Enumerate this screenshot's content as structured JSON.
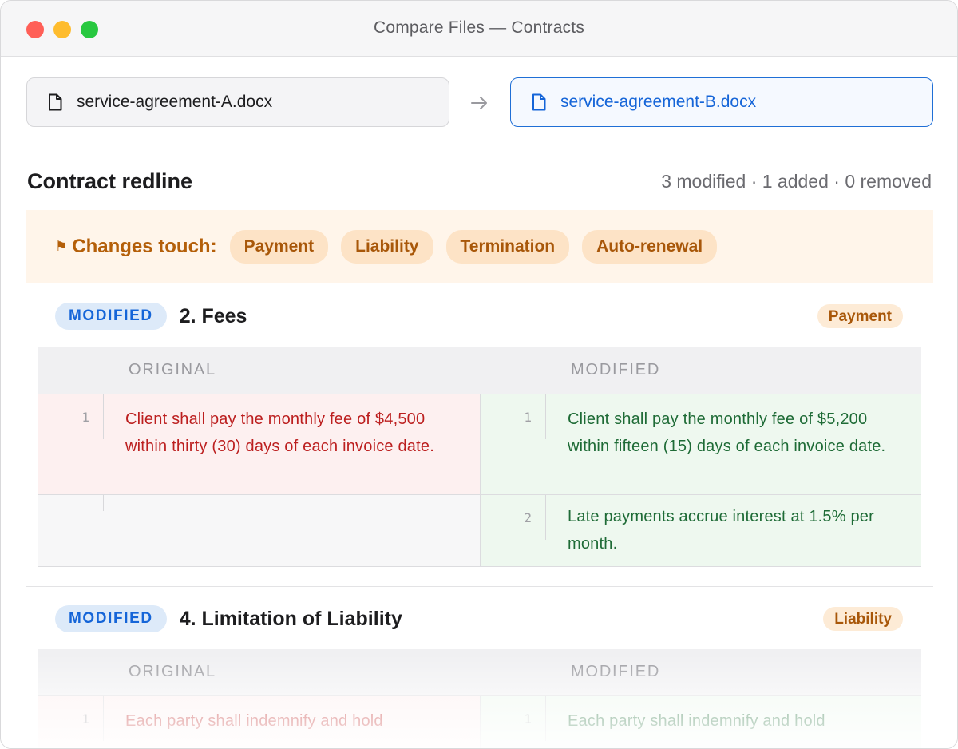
{
  "window": {
    "title": "Compare Files — Contracts"
  },
  "files": {
    "original": {
      "name": "service-agreement-A.docx",
      "icon": "document-icon"
    },
    "arrow_icon": "arrow-right-icon",
    "modified": {
      "name": "service-agreement-B.docx",
      "icon": "document-icon"
    }
  },
  "summary": {
    "title": "Contract redline",
    "counts": "3 modified · 1 added · 0 removed"
  },
  "touches": {
    "flag": "⚑",
    "label": "Changes touch:",
    "chips": [
      "Payment",
      "Liability",
      "Termination",
      "Auto-renewal"
    ]
  },
  "sections": [
    {
      "badge": "MODIFIED",
      "title": "2. Fees",
      "category": "Payment",
      "original_header": "ORIGINAL",
      "modified_header": "MODIFIED",
      "rows": [
        {
          "left_num": "1",
          "left_text": "Client shall pay the monthly fee of $4,500 within thirty (30) days of each invoice date.",
          "right_num": "1",
          "right_text": "Client shall pay the monthly fee of $5,200 within fifteen (15) days of each invoice date."
        },
        {
          "left_num": "",
          "left_text": "",
          "right_num": "2",
          "right_text": "Late payments accrue interest at 1.5% per month."
        }
      ]
    },
    {
      "badge": "MODIFIED",
      "title": "4. Limitation of Liability",
      "category": "Liability",
      "original_header": "ORIGINAL",
      "modified_header": "MODIFIED",
      "rows": [
        {
          "left_num": "1",
          "left_text": "Each party shall indemnify and hold",
          "right_num": "1",
          "right_text": "Each party shall indemnify and hold"
        }
      ]
    }
  ],
  "colors": {
    "accent": "#1565d8",
    "deleted_text": "#bc1f1f",
    "added_text": "#1e6b36",
    "warning": "#b45f09"
  }
}
